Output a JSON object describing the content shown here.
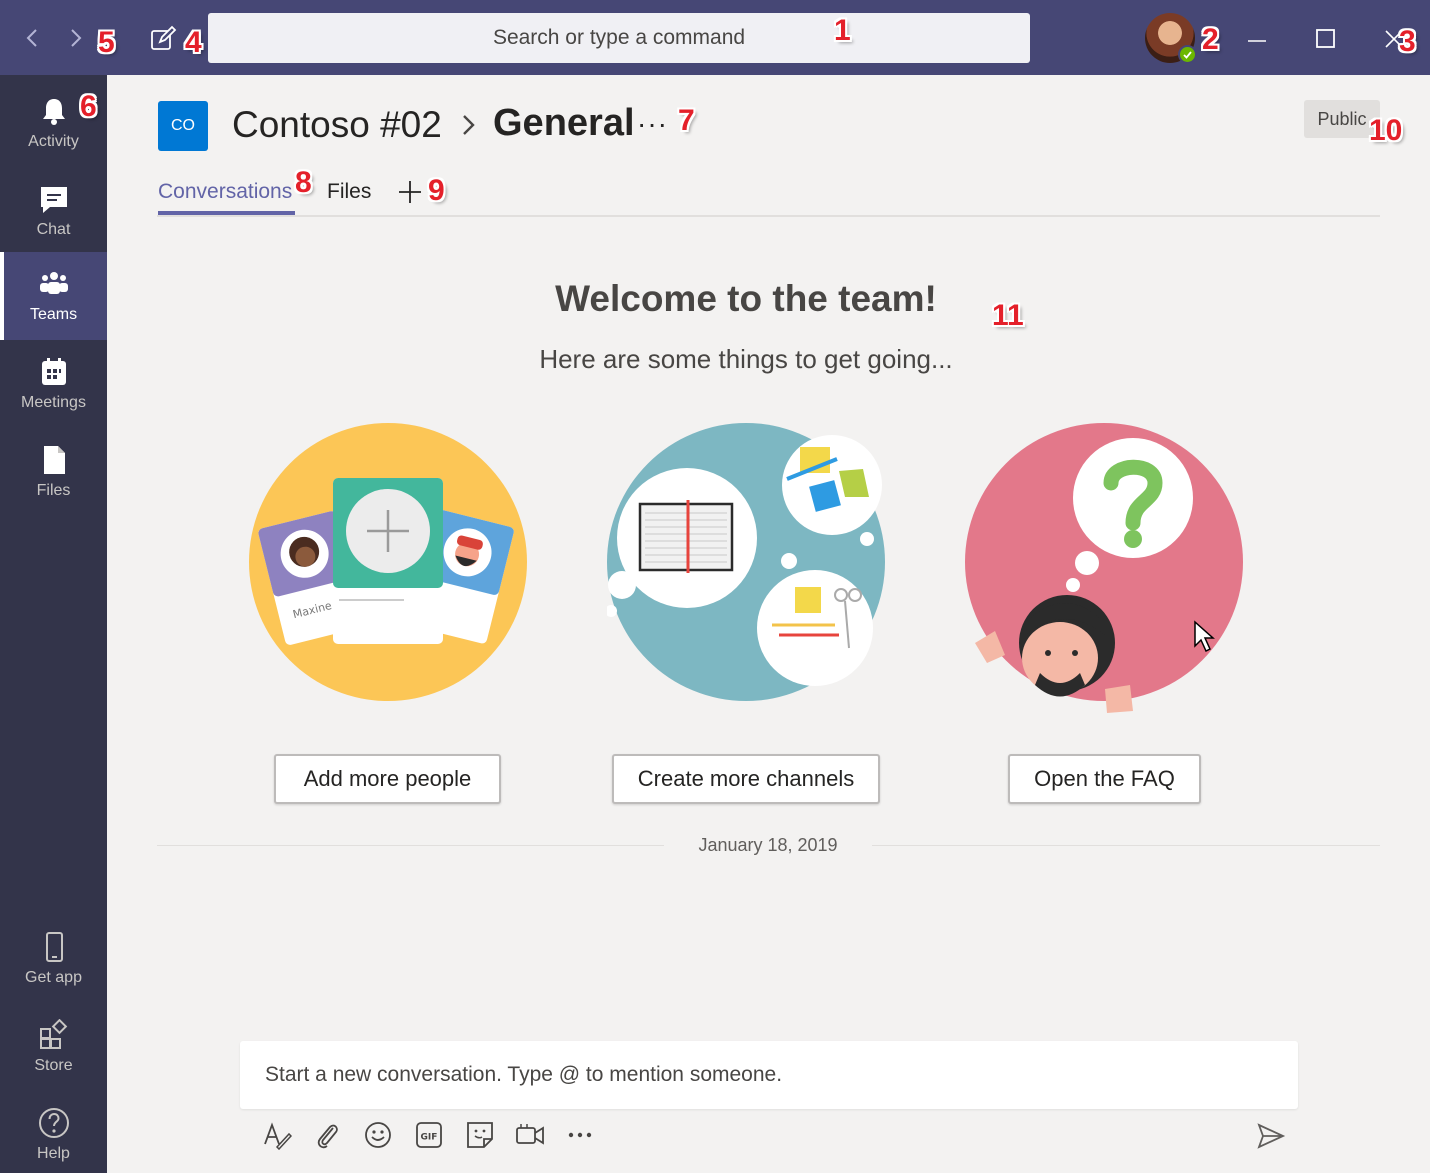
{
  "titlebar": {
    "search_placeholder": "Search or type a command"
  },
  "callouts": [
    "1",
    "2",
    "3",
    "4",
    "5",
    "6",
    "7",
    "8",
    "9",
    "10",
    "11"
  ],
  "rail": {
    "items": [
      {
        "label": "Activity",
        "icon": "bell-icon"
      },
      {
        "label": "Chat",
        "icon": "chat-icon"
      },
      {
        "label": "Teams",
        "icon": "teams-icon"
      },
      {
        "label": "Meetings",
        "icon": "calendar-icon"
      },
      {
        "label": "Files",
        "icon": "file-icon"
      }
    ],
    "bottom": [
      {
        "label": "Get app",
        "icon": "phone-icon"
      },
      {
        "label": "Store",
        "icon": "store-icon"
      },
      {
        "label": "Help",
        "icon": "help-icon"
      }
    ]
  },
  "header": {
    "team_initials": "CO",
    "team_name": "Contoso #02",
    "channel_name": "General",
    "more": "···",
    "visibility": "Public"
  },
  "tabs": {
    "conversations": "Conversations",
    "files": "Files"
  },
  "welcome": {
    "title": "Welcome to the team!",
    "subtitle": "Here are some things to get going...",
    "card_names": [
      "Maxine",
      "ky"
    ],
    "actions": [
      "Add more people",
      "Create more channels",
      "Open the FAQ"
    ]
  },
  "timeline": {
    "date": "January 18, 2019"
  },
  "composer": {
    "placeholder": "Start a new conversation. Type @ to mention someone."
  },
  "colors": {
    "titlebar": "#464775",
    "rail": "#33344a",
    "accent": "#6264a7",
    "team_tile": "#0078d4",
    "callout": "#e4202a"
  }
}
